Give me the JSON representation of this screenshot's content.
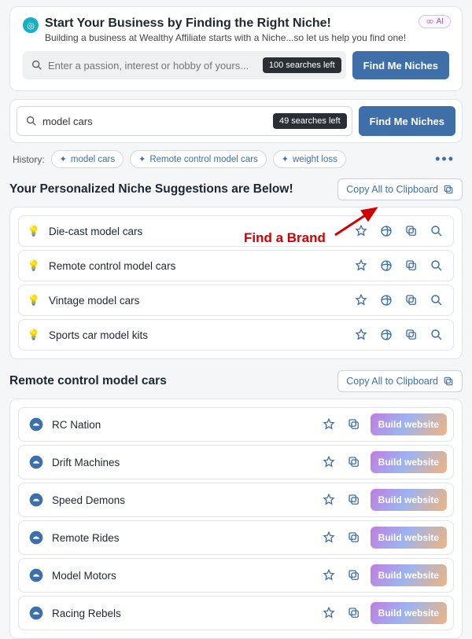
{
  "promo": {
    "title": "Start Your Business by Finding the Right Niche!",
    "subtitle": "Building a business at Wealthy Affiliate starts with a Niche...so let us help you find one!",
    "ai_label": "AI",
    "search_placeholder": "Enter a passion, interest or hobby of yours...",
    "counter": "100 searches left",
    "button": "Find Me Niches"
  },
  "main_search": {
    "value": "model cars",
    "counter": "49 searches left",
    "button": "Find Me Niches"
  },
  "history": {
    "label": "History:",
    "items": [
      "model cars",
      "Remote control model cars",
      "weight loss"
    ]
  },
  "suggestions": {
    "title": "Your Personalized Niche Suggestions are Below!",
    "copy_all": "Copy All to Clipboard",
    "items": [
      "Die-cast model cars",
      "Remote control model cars",
      "Vintage model cars",
      "Sports car model kits"
    ]
  },
  "annotation": {
    "text": "Find a Brand"
  },
  "brands": {
    "title": "Remote control model cars",
    "copy_all": "Copy All to Clipboard",
    "build_label": "Build website",
    "items": [
      "RC Nation",
      "Drift Machines",
      "Speed Demons",
      "Remote Rides",
      "Model Motors",
      "Racing Rebels"
    ]
  }
}
